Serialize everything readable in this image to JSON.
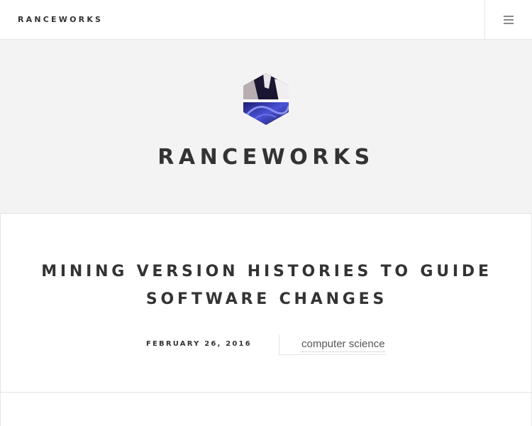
{
  "header": {
    "site_name": "RANCEWORKS",
    "menu_icon": "hamburger-menu-icon"
  },
  "hero": {
    "logo_icon": "site-logo-hexagon",
    "title": "RANCEWORKS"
  },
  "post": {
    "title": "MINING VERSION HISTORIES TO GUIDE SOFTWARE CHANGES",
    "date": "FEBRUARY 26, 2016",
    "category": "computer science"
  },
  "colors": {
    "text": "#333333",
    "hero_background": "#f3f3f3",
    "border": "#e5e5e5",
    "logo_blue": "#3a3fb0"
  }
}
